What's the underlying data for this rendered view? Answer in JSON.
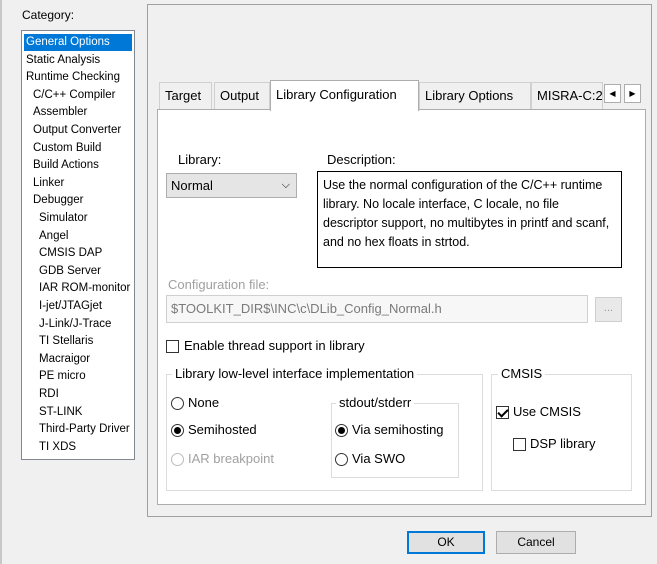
{
  "category": {
    "label": "Category:",
    "items": [
      {
        "label": "General Options",
        "indent": 0,
        "selected": true
      },
      {
        "label": "Static Analysis",
        "indent": 0
      },
      {
        "label": "Runtime Checking",
        "indent": 0
      },
      {
        "label": "C/C++ Compiler",
        "indent": 1
      },
      {
        "label": "Assembler",
        "indent": 1
      },
      {
        "label": "Output Converter",
        "indent": 1
      },
      {
        "label": "Custom Build",
        "indent": 1
      },
      {
        "label": "Build Actions",
        "indent": 1
      },
      {
        "label": "Linker",
        "indent": 1
      },
      {
        "label": "Debugger",
        "indent": 1
      },
      {
        "label": "Simulator",
        "indent": 2
      },
      {
        "label": "Angel",
        "indent": 2
      },
      {
        "label": "CMSIS DAP",
        "indent": 2
      },
      {
        "label": "GDB Server",
        "indent": 2
      },
      {
        "label": "IAR ROM-monitor",
        "indent": 2
      },
      {
        "label": "I-jet/JTAGjet",
        "indent": 2
      },
      {
        "label": "J-Link/J-Trace",
        "indent": 2
      },
      {
        "label": "TI Stellaris",
        "indent": 2
      },
      {
        "label": "Macraigor",
        "indent": 2
      },
      {
        "label": "PE micro",
        "indent": 2
      },
      {
        "label": "RDI",
        "indent": 2
      },
      {
        "label": "ST-LINK",
        "indent": 2
      },
      {
        "label": "Third-Party Driver",
        "indent": 2
      },
      {
        "label": "TI XDS",
        "indent": 2
      }
    ]
  },
  "tabs": [
    {
      "label": "Target"
    },
    {
      "label": "Output"
    },
    {
      "label": "Library Configuration",
      "active": true
    },
    {
      "label": "Library Options"
    },
    {
      "label": "MISRA-C:2"
    }
  ],
  "tab_scroll": {
    "left": "◀",
    "right": "▶"
  },
  "library": {
    "label": "Library:",
    "selected": "Normal",
    "chevron": "⌵"
  },
  "description": {
    "label": "Description:",
    "text": "Use the normal configuration of the C/C++ runtime library. No locale interface, C locale, no file descriptor support, no multibytes in printf and scanf, and no hex floats in strtod."
  },
  "config_file": {
    "label": "Configuration file:",
    "value": "$TOOLKIT_DIR$\\INC\\c\\DLib_Config_Normal.h",
    "browse": "..."
  },
  "thread_support": {
    "label": "Enable thread support in library",
    "checked": false
  },
  "lowlevel": {
    "title": "Library low-level interface implementation",
    "none": "None",
    "semihosted": "Semihosted",
    "iar_breakpoint": "IAR breakpoint",
    "stdout_title": "stdout/stderr",
    "via_semihosting": "Via semihosting",
    "via_swo": "Via SWO"
  },
  "cmsis": {
    "title": "CMSIS",
    "use_cmsis": "Use CMSIS",
    "dsp_library": "DSP library"
  },
  "footer": {
    "ok": "OK",
    "cancel": "Cancel"
  }
}
